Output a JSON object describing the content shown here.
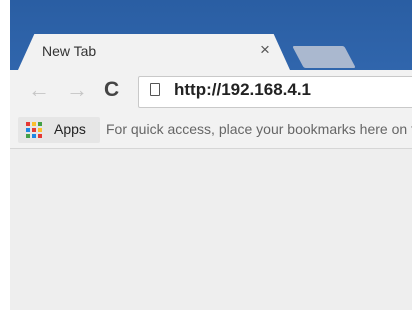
{
  "tab": {
    "title": "New Tab",
    "close_glyph": "×",
    "close_icon": "close-icon"
  },
  "toolbar": {
    "back_glyph": "←",
    "forward_glyph": "→",
    "reload_glyph": "C",
    "back_icon": "arrow-left-icon",
    "forward_icon": "arrow-right-icon",
    "reload_icon": "reload-icon",
    "address": "http://192.168.4.1",
    "page_icon": "page-icon"
  },
  "bookmarks": {
    "apps_label": "Apps",
    "apps_icon": "apps-grid-icon",
    "hint": "For quick access, place your bookmarks here on the bookmarks bar."
  },
  "colors": {
    "title_bar": "#3a72bc",
    "toolbar": "#f2f2f2",
    "content": "#eeeeee",
    "inactive_tab": "#aab8cf",
    "disabled_arrow": "#c6c6c6"
  }
}
